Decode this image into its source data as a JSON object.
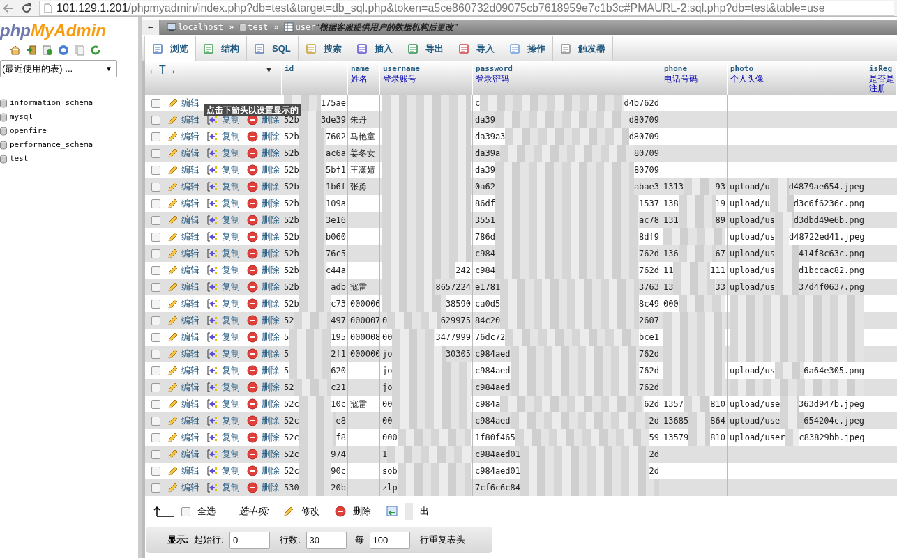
{
  "browser": {
    "url_host": "101.129.1.201",
    "url_rest": "/phpmyadmin/index.php?db=test&target=db_sql.php&token=a5ce860732d09075cb7618959e7c1b3c#PMAURL-2:sql.php?db=test&table=use"
  },
  "sidebar": {
    "logo_a": "php",
    "logo_b": "MyAdmin",
    "recent_select": "(最近使用的表) ...",
    "recent_caret": "▼",
    "databases": [
      "information_schema",
      "mysql",
      "openfire",
      "performance_schema",
      "test"
    ]
  },
  "breadcrumb": {
    "back": "←",
    "items": [
      {
        "kind": "server",
        "label": "localhost"
      },
      {
        "kind": "database",
        "label": "test"
      },
      {
        "kind": "table",
        "label": "user"
      }
    ],
    "separator": "»",
    "comment": "“根据客服提供用户的数据机构后更改”"
  },
  "tabs": [
    {
      "label": "浏览",
      "selected": true
    },
    {
      "label": "结构",
      "selected": false
    },
    {
      "label": "SQL",
      "selected": false
    },
    {
      "label": "搜索",
      "selected": false
    },
    {
      "label": "插入",
      "selected": false
    },
    {
      "label": "导出",
      "selected": false
    },
    {
      "label": "导入",
      "selected": false
    },
    {
      "label": "操作",
      "selected": false
    },
    {
      "label": "触发器",
      "selected": false
    }
  ],
  "table": {
    "resize_label": "←T→",
    "sort_caret": "▼",
    "columns": [
      {
        "name": "id"
      },
      {
        "name": "name",
        "comment": [
          "姓名"
        ]
      },
      {
        "name": "username",
        "comment": [
          "登录账号"
        ]
      },
      {
        "name": "password",
        "comment": [
          "登录密码"
        ]
      },
      {
        "name": "phone",
        "comment": [
          "电话号码"
        ]
      },
      {
        "name": "photo",
        "comment": [
          "个人头像"
        ]
      },
      {
        "name": "isReg",
        "comment": [
          "是否是",
          "注册"
        ]
      }
    ],
    "tooltip": "点击下箭头以设置显示的",
    "rows": [
      {
        "checked": false,
        "actions": {
          "edit": "编辑"
        },
        "cells": [
          {
            "end": "175ae",
            "censored": true
          },
          "",
          {
            "censored": true
          },
          {
            "start": "c",
            "end": "d4b762d",
            "censored": true
          },
          "",
          ""
        ]
      },
      {
        "checked": false,
        "actions": {
          "edit": "编辑",
          "copy": "复制",
          "delete": "删除"
        },
        "cells": [
          {
            "start": "52b",
            "end": "3de39",
            "censored": true
          },
          "朱丹",
          {
            "censored": true
          },
          {
            "start": "da39",
            "end": "d80709",
            "censored": true
          },
          "",
          ""
        ]
      },
      {
        "checked": false,
        "actions": {
          "edit": "编辑",
          "copy": "复制",
          "delete": "删除"
        },
        "cells": [
          {
            "start": "52b",
            "end": "7602",
            "censored": true
          },
          "马艳童",
          {
            "censored": true
          },
          {
            "start": "da39a3",
            "end": "d80709",
            "censored": true
          },
          "",
          ""
        ]
      },
      {
        "checked": false,
        "actions": {
          "edit": "编辑",
          "copy": "复制",
          "delete": "删除"
        },
        "cells": [
          {
            "start": "52b",
            "end": "ac6a",
            "censored": true
          },
          "姜冬女",
          {
            "censored": true
          },
          {
            "start": "da39a",
            "end": "80709",
            "censored": true
          },
          "",
          ""
        ]
      },
      {
        "checked": false,
        "actions": {
          "edit": "编辑",
          "copy": "复制",
          "delete": "删除"
        },
        "cells": [
          {
            "start": "52b",
            "end": "5bf1",
            "censored": true
          },
          "王潇婧",
          {
            "censored": true
          },
          {
            "start": "da39",
            "end": "80709",
            "censored": true
          },
          "",
          ""
        ]
      },
      {
        "checked": false,
        "actions": {
          "edit": "编辑",
          "copy": "复制",
          "delete": "删除"
        },
        "cells": [
          {
            "start": "52b",
            "end": "1b6f",
            "censored": true
          },
          "张勇",
          {
            "censored": true
          },
          {
            "start": "0a62",
            "end": "abae3",
            "censored": true
          },
          {
            "start": "1313",
            "end": "93",
            "censored": true
          },
          {
            "start": "upload/u",
            "end": "d4879ae654.jpeg",
            "censored": true
          }
        ]
      },
      {
        "checked": false,
        "actions": {
          "edit": "编辑",
          "copy": "复制",
          "delete": "删除"
        },
        "cells": [
          {
            "start": "52b",
            "end": "109a",
            "censored": true
          },
          "",
          {
            "censored": true
          },
          {
            "start": "86df",
            "end": "1537",
            "censored": true
          },
          {
            "start": "138",
            "end": "19",
            "censored": true
          },
          {
            "start": "upload/u",
            "end": "d3c6f6236c.png",
            "censored": true
          }
        ]
      },
      {
        "checked": false,
        "actions": {
          "edit": "编辑",
          "copy": "复制",
          "delete": "删除"
        },
        "cells": [
          {
            "start": "52b",
            "end": "3e16",
            "censored": true
          },
          "",
          {
            "censored": true
          },
          {
            "start": "3551",
            "end": "ac78",
            "censored": true
          },
          {
            "start": "131",
            "end": "89",
            "censored": true
          },
          {
            "start": "upload/us",
            "end": "d3dbd49e6b.png",
            "censored": true
          }
        ]
      },
      {
        "checked": false,
        "actions": {
          "edit": "编辑",
          "copy": "复制",
          "delete": "删除"
        },
        "cells": [
          {
            "start": "52b",
            "end": "b060",
            "censored": true
          },
          "",
          {
            "censored": true
          },
          {
            "start": "786d",
            "end": "8df9",
            "censored": true
          },
          {
            "censored": true
          },
          {
            "start": "upload/us",
            "end": "d48722ed41.jpeg",
            "censored": true
          }
        ]
      },
      {
        "checked": false,
        "actions": {
          "edit": "编辑",
          "copy": "复制",
          "delete": "删除"
        },
        "cells": [
          {
            "start": "52b",
            "end": "76c5",
            "censored": true
          },
          "",
          {
            "censored": true
          },
          {
            "start": "c984",
            "end": "762d",
            "censored": true
          },
          {
            "start": "136",
            "end": "67",
            "censored": true
          },
          {
            "start": "upload/us",
            "end": "414f8c63c.png",
            "censored": true
          }
        ]
      },
      {
        "checked": false,
        "actions": {
          "edit": "编辑",
          "copy": "复制",
          "delete": "删除"
        },
        "cells": [
          {
            "start": "52b",
            "end": "c44a",
            "censored": true
          },
          "",
          {
            "end": "242",
            "censored": true
          },
          {
            "start": "c984",
            "end": "762d",
            "censored": true
          },
          {
            "start": "11",
            "end": "111",
            "censored": true
          },
          {
            "start": "upload/us",
            "end": "d1bccac82.png",
            "censored": true
          }
        ]
      },
      {
        "checked": false,
        "actions": {
          "edit": "编辑",
          "copy": "复制",
          "delete": "删除"
        },
        "cells": [
          {
            "start": "52b",
            "end": "adb",
            "censored": true
          },
          "寇雷",
          {
            "end": "8657224",
            "censored": true
          },
          {
            "start": "e1781",
            "end": "3763",
            "censored": true
          },
          {
            "start": "13",
            "end": "33",
            "censored": true
          },
          {
            "start": "upload/us",
            "end": "37d4f0637.png",
            "censored": true
          }
        ]
      },
      {
        "checked": false,
        "actions": {
          "edit": "编辑",
          "copy": "复制",
          "delete": "删除"
        },
        "cells": [
          {
            "start": "52b",
            "end": "c73",
            "censored": true
          },
          "000006",
          {
            "end": "38590",
            "censored": true
          },
          {
            "start": "ca0d5",
            "end": "8c49",
            "censored": true
          },
          {
            "start": "000",
            "censored": true
          },
          {
            "censored": true
          }
        ]
      },
      {
        "checked": false,
        "actions": {
          "edit": "编辑",
          "copy": "复制",
          "delete": "删除"
        },
        "cells": [
          {
            "start": "52",
            "end": "497",
            "censored": true
          },
          "000007",
          {
            "start": "0",
            "end": "629975",
            "censored": true
          },
          {
            "start": "84c20",
            "end": "2607",
            "censored": true
          },
          {
            "censored": true
          },
          {
            "censored": true
          }
        ]
      },
      {
        "checked": false,
        "actions": {
          "edit": "编辑",
          "copy": "复制",
          "delete": "删除"
        },
        "cells": [
          {
            "start": "5",
            "end": "195",
            "censored": true
          },
          "000008",
          {
            "start": "00",
            "end": "3477999",
            "censored": true
          },
          {
            "start": "76dc72",
            "end": "bce1",
            "censored": true
          },
          {
            "censored": true
          },
          {
            "censored": true
          }
        ]
      },
      {
        "checked": false,
        "actions": {
          "edit": "编辑",
          "copy": "复制",
          "delete": "删除"
        },
        "cells": [
          {
            "start": "5",
            "end": "2f1",
            "censored": true
          },
          "000000",
          {
            "start": "jo",
            "end": "30305",
            "censored": true
          },
          {
            "start": "c984aed",
            "end": "762d",
            "censored": true
          },
          {
            "censored": true
          },
          {
            "censored": true
          }
        ]
      },
      {
        "checked": false,
        "actions": {
          "edit": "编辑",
          "copy": "复制",
          "delete": "删除"
        },
        "cells": [
          {
            "start": "5",
            "end": "620",
            "censored": true
          },
          "",
          {
            "start": "jo",
            "censored": true
          },
          {
            "start": "c984aed",
            "end": "762d",
            "censored": true
          },
          {
            "censored": true
          },
          {
            "start": "upload/us",
            "end": "6a64e305.png",
            "censored": true
          }
        ]
      },
      {
        "checked": false,
        "actions": {
          "edit": "编辑",
          "copy": "复制",
          "delete": "删除"
        },
        "cells": [
          {
            "start": "52",
            "end": "c21",
            "censored": true
          },
          "",
          {
            "start": "jo",
            "censored": true
          },
          {
            "start": "c984aed",
            "end": "762d",
            "censored": true
          },
          {
            "censored": true
          },
          {
            "censored": true
          }
        ]
      },
      {
        "checked": false,
        "actions": {
          "edit": "编辑",
          "copy": "复制",
          "delete": "删除"
        },
        "cells": [
          {
            "start": "52c",
            "end": "10c",
            "censored": true
          },
          "寇雷",
          {
            "start": "00",
            "censored": true
          },
          {
            "start": "c984a",
            "end": "62d",
            "censored": true
          },
          {
            "start": "1357",
            "end": "810",
            "censored": true
          },
          {
            "start": "upload/use",
            "end": "363d947b.jpeg",
            "censored": true
          }
        ]
      },
      {
        "checked": false,
        "actions": {
          "edit": "编辑",
          "copy": "复制",
          "delete": "删除"
        },
        "cells": [
          {
            "start": "52c",
            "end": "e8",
            "censored": true
          },
          "",
          {
            "start": "00",
            "censored": true
          },
          {
            "start": "c984aed",
            "end": "2d",
            "censored": true
          },
          {
            "start": "13685",
            "end": "864",
            "censored": true
          },
          {
            "start": "upload/use",
            "end": "654204c.jpeg",
            "censored": true
          }
        ]
      },
      {
        "checked": false,
        "actions": {
          "edit": "编辑",
          "copy": "复制",
          "delete": "删除"
        },
        "cells": [
          {
            "start": "52c",
            "end": "f8",
            "censored": true
          },
          "",
          {
            "start": "000",
            "censored": true
          },
          {
            "start": "1f80f465",
            "end": "59",
            "censored": true
          },
          {
            "start": "13579",
            "end": "810",
            "censored": true
          },
          {
            "start": "upload/user",
            "end": "c83829bb.jpeg",
            "censored": true
          }
        ]
      },
      {
        "checked": false,
        "actions": {
          "edit": "编辑",
          "copy": "复制",
          "delete": "删除"
        },
        "cells": [
          {
            "start": "52c",
            "end": "974",
            "censored": true
          },
          "",
          {
            "start": "1",
            "censored": true
          },
          {
            "start": "c984aed01",
            "end": "2d",
            "censored": true
          },
          "",
          ""
        ]
      },
      {
        "checked": false,
        "actions": {
          "edit": "编辑",
          "copy": "复制",
          "delete": "删除"
        },
        "cells": [
          {
            "start": "52c",
            "end": "90c",
            "censored": true
          },
          "",
          {
            "start": "sob",
            "censored": true
          },
          {
            "start": "c984aed01",
            "end": "2d",
            "censored": true
          },
          "",
          ""
        ]
      },
      {
        "checked": false,
        "actions": {
          "edit": "编辑",
          "copy": "复制",
          "delete": "删除"
        },
        "cells": [
          {
            "start": "530",
            "end": "20b",
            "censored": true
          },
          "",
          {
            "start": "zlp",
            "censored": true
          },
          {
            "start": "7cf6c6c84",
            "censored": true
          },
          "",
          ""
        ]
      }
    ]
  },
  "bulk": {
    "check_all_label": "全选",
    "check_all": false,
    "with_selected": "选中项:",
    "edit": "修改",
    "delete": "删除",
    "export": "出"
  },
  "display": {
    "label": "显示:",
    "start_label": "起始行:",
    "start": "0",
    "rows_label": "行数:",
    "rows": "30",
    "every_label": "每",
    "every": "100",
    "repeat_label": "行重复表头"
  }
}
